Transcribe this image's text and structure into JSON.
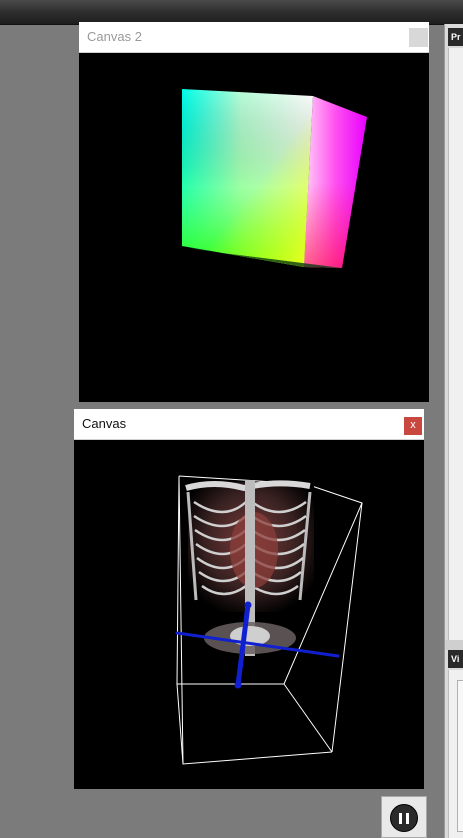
{
  "windows": {
    "canvas2": {
      "title": "Canvas 2",
      "control_icon": "square-icon"
    },
    "canvas": {
      "title": "Canvas",
      "close_label": "x"
    }
  },
  "right_panel": {
    "top_header": "Pr",
    "bottom_header": "Vi"
  },
  "controls": {
    "playback_icon": "pause-icon"
  },
  "colors": {
    "topbar": "#2c2c2c",
    "desktop": "#7b7b7b",
    "close_button": "#c8473f",
    "axis_blue": "#1020d0"
  }
}
